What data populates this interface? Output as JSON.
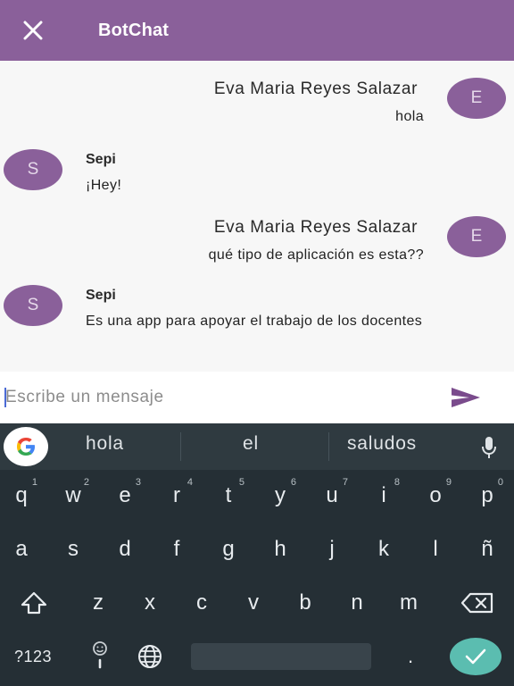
{
  "appbar": {
    "title": "BotChat",
    "close_icon": "close-icon"
  },
  "messages": [
    {
      "side": "right",
      "avatar": "E",
      "sender": "Eva Maria Reyes Salazar",
      "text": "hola"
    },
    {
      "side": "left",
      "avatar": "S",
      "sender": "Sepi",
      "text": "¡Hey!"
    },
    {
      "side": "right",
      "avatar": "E",
      "sender": "Eva Maria Reyes Salazar",
      "text": "qué tipo de aplicación es esta??"
    },
    {
      "side": "left",
      "avatar": "S",
      "sender": "Sepi",
      "text": "Es una app para apoyar el trabajo de los docentes"
    }
  ],
  "input": {
    "placeholder": "Escribe un mensaje",
    "value": "",
    "send_icon": "send-icon"
  },
  "keyboard": {
    "suggestions": [
      "hola",
      "el",
      "saludos"
    ],
    "row1": [
      {
        "k": "q",
        "h": "1"
      },
      {
        "k": "w",
        "h": "2"
      },
      {
        "k": "e",
        "h": "3"
      },
      {
        "k": "r",
        "h": "4"
      },
      {
        "k": "t",
        "h": "5"
      },
      {
        "k": "y",
        "h": "6"
      },
      {
        "k": "u",
        "h": "7"
      },
      {
        "k": "i",
        "h": "8"
      },
      {
        "k": "o",
        "h": "9"
      },
      {
        "k": "p",
        "h": "0"
      }
    ],
    "row2": [
      "a",
      "s",
      "d",
      "f",
      "g",
      "h",
      "j",
      "k",
      "l",
      "ñ"
    ],
    "row3": [
      "z",
      "x",
      "c",
      "v",
      "b",
      "n",
      "m"
    ],
    "sym_label": "?123",
    "period_label": ".",
    "icons": [
      "google-g-icon",
      "mic-icon",
      "shift-icon",
      "backspace-icon",
      "emoji-icon",
      "globe-icon",
      "check-icon"
    ],
    "colors": {
      "bg": "#252f35",
      "suggest_bg": "#2f3a40",
      "enter": "#5bbdb0"
    }
  },
  "colors": {
    "primary": "#8a609a",
    "background": "#f7f7f7"
  }
}
